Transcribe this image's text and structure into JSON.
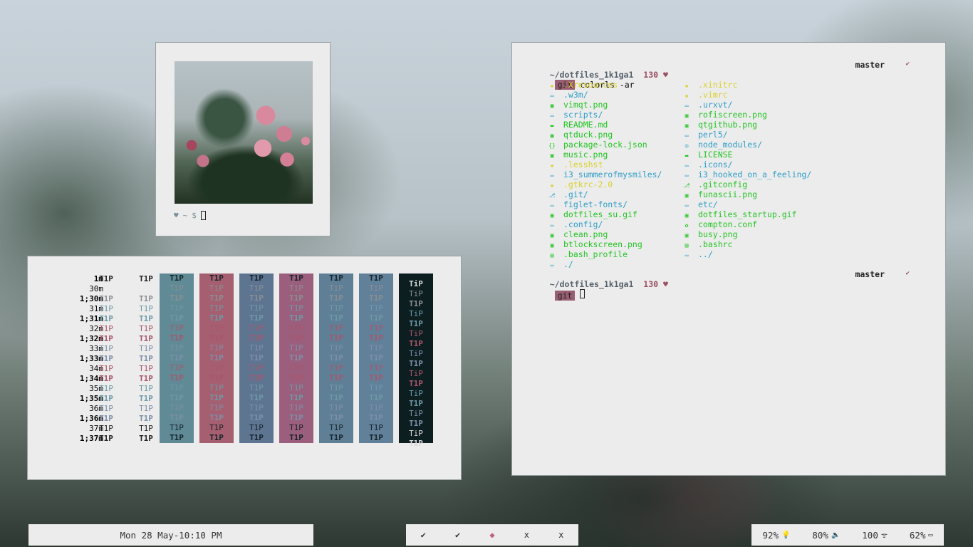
{
  "photo_window": {
    "prompt": {
      "heart": "♥",
      "tilde": "~",
      "dollar": "$"
    }
  },
  "colors_window": {
    "labels": [
      "1m",
      "30m",
      "1;30m",
      "31m",
      "1;31m",
      "32m",
      "1;32m",
      "33m",
      "1;33m",
      "34m",
      "1;34m",
      "35m",
      "1;35m",
      "36m",
      "1;36m",
      "37m",
      "1;37m"
    ],
    "cell_text": "T1P",
    "alt_cell_text": "TiP",
    "column_backgrounds": [
      "#5f8a96",
      "#a55f70",
      "#5e7592",
      "#9b5e7c",
      "#5f7f97",
      "#61809a",
      "#0d1e21"
    ],
    "accent_colors": {
      "red": "#a9566b",
      "green": "#6e9aa6",
      "yellow": "#7a8ba4",
      "blue": "#7e8fa9"
    }
  },
  "terminal": {
    "prompt1": {
      "path": "~/dotfiles_1k1ga1",
      "code": "130",
      "heart": "♥",
      "branch": "master",
      "tick": "✔",
      "badge": "git",
      "command": "colorls -ar"
    },
    "files_left": [
      {
        "name": ".Xresources",
        "color": "#d9d12e",
        "icon": "▪"
      },
      {
        "name": ".w3m/",
        "color": "#2f9ec7",
        "icon": "▭"
      },
      {
        "name": "vimqt.png",
        "color": "#25c425",
        "icon": "▣"
      },
      {
        "name": "scripts/",
        "color": "#2f9ec7",
        "icon": "▭"
      },
      {
        "name": "README.md",
        "color": "#25c425",
        "icon": "▬"
      },
      {
        "name": "qtduck.png",
        "color": "#25c425",
        "icon": "▣"
      },
      {
        "name": "package-lock.json",
        "color": "#25c425",
        "icon": "{}"
      },
      {
        "name": "music.png",
        "color": "#25c425",
        "icon": "▣"
      },
      {
        "name": ".lesshst",
        "color": "#d9d12e",
        "icon": "▪"
      },
      {
        "name": "i3_summerofmysmiles/",
        "color": "#2f9ec7",
        "icon": "▭"
      },
      {
        "name": ".gtkrc-2.0",
        "color": "#d9d12e",
        "icon": "▪"
      },
      {
        "name": ".git/",
        "color": "#2f9ec7",
        "icon": "⎇"
      },
      {
        "name": "figlet-fonts/",
        "color": "#2f9ec7",
        "icon": "▭"
      },
      {
        "name": "dotfiles_su.gif",
        "color": "#25c425",
        "icon": "▣"
      },
      {
        "name": ".config/",
        "color": "#2f9ec7",
        "icon": "▭"
      },
      {
        "name": "clean.png",
        "color": "#25c425",
        "icon": "▣"
      },
      {
        "name": "btlockscreen.png",
        "color": "#25c425",
        "icon": "▣"
      },
      {
        "name": ".bash_profile",
        "color": "#25c425",
        "icon": "▤"
      },
      {
        "name": "./",
        "color": "#2f9ec7",
        "icon": "▭"
      }
    ],
    "files_right": [
      {
        "name": ".xinitrc",
        "color": "#d9d12e",
        "icon": "▪"
      },
      {
        "name": ".vimrc",
        "color": "#d9d12e",
        "icon": "▪"
      },
      {
        "name": ".urxvt/",
        "color": "#2f9ec7",
        "icon": "▭"
      },
      {
        "name": "rofiscreen.png",
        "color": "#25c425",
        "icon": "▣"
      },
      {
        "name": "qtgithub.png",
        "color": "#25c425",
        "icon": "▣"
      },
      {
        "name": "perl5/",
        "color": "#2f9ec7",
        "icon": "▭"
      },
      {
        "name": "node_modules/",
        "color": "#2f9ec7",
        "icon": "◎"
      },
      {
        "name": "LICENSE",
        "color": "#25c425",
        "icon": "▬"
      },
      {
        "name": ".icons/",
        "color": "#2f9ec7",
        "icon": "▭"
      },
      {
        "name": "i3_hooked_on_a_feeling/",
        "color": "#2f9ec7",
        "icon": "▭"
      },
      {
        "name": ".gitconfig",
        "color": "#25c425",
        "icon": "⎇"
      },
      {
        "name": "funascii.png",
        "color": "#25c425",
        "icon": "▣"
      },
      {
        "name": "etc/",
        "color": "#2f9ec7",
        "icon": "▭"
      },
      {
        "name": "dotfiles_startup.gif",
        "color": "#25c425",
        "icon": "▣"
      },
      {
        "name": "compton.conf",
        "color": "#25c425",
        "icon": "✿"
      },
      {
        "name": "busy.png",
        "color": "#25c425",
        "icon": "▣"
      },
      {
        "name": ".bashrc",
        "color": "#25c425",
        "icon": "▤"
      },
      {
        "name": "../",
        "color": "#2f9ec7",
        "icon": "▭"
      }
    ],
    "prompt2": {
      "path": "~/dotfiles_1k1ga1",
      "code": "130",
      "heart": "♥",
      "branch": "master",
      "tick": "✔",
      "badge": "git"
    }
  },
  "bar": {
    "clock": "Mon 28 May-10:10 PM",
    "workspaces": [
      {
        "label": "✔",
        "icon": "check-icon"
      },
      {
        "label": "✔",
        "icon": "check-icon"
      },
      {
        "label": "◆",
        "icon": "gem-icon"
      },
      {
        "label": "x",
        "icon": "x-icon"
      },
      {
        "label": "x",
        "icon": "x-icon"
      }
    ],
    "stats": [
      {
        "value": "92%",
        "icon": "bulb-icon",
        "glyph": "💡"
      },
      {
        "value": "80%",
        "icon": "volume-icon",
        "glyph": "🔈"
      },
      {
        "value": "100",
        "icon": "wifi-icon",
        "glyph": "ᯤ"
      },
      {
        "value": "62%",
        "icon": "battery-icon",
        "glyph": "▭"
      }
    ]
  }
}
